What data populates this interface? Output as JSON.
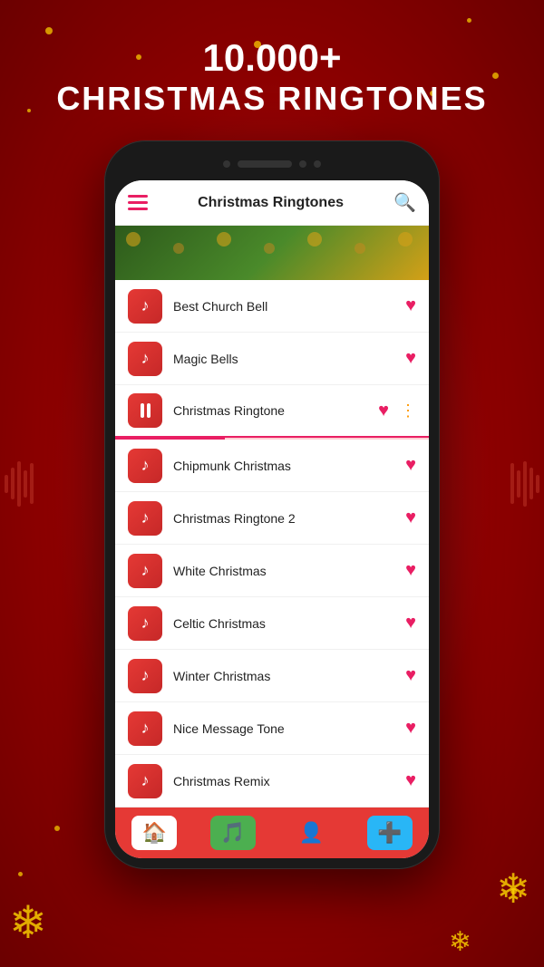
{
  "background": {
    "title_line1": "10.000+",
    "title_line2": "CHRISTMAS RINGTONES"
  },
  "app": {
    "header_title": "Christmas Ringtones",
    "search_icon": "🔍"
  },
  "ringtones": [
    {
      "id": 1,
      "name": "Best Church Bell",
      "playing": false,
      "liked": true
    },
    {
      "id": 2,
      "name": "Magic Bells",
      "playing": false,
      "liked": true
    },
    {
      "id": 3,
      "name": "Christmas Ringtone",
      "playing": true,
      "liked": true,
      "has_more": true
    },
    {
      "id": 4,
      "name": "Chipmunk Christmas",
      "playing": false,
      "liked": true
    },
    {
      "id": 5,
      "name": "Christmas Ringtone 2",
      "playing": false,
      "liked": true
    },
    {
      "id": 6,
      "name": "White Christmas",
      "playing": false,
      "liked": true
    },
    {
      "id": 7,
      "name": "Celtic Christmas",
      "playing": false,
      "liked": true
    },
    {
      "id": 8,
      "name": "Winter Christmas",
      "playing": false,
      "liked": true
    },
    {
      "id": 9,
      "name": "Nice Message Tone",
      "playing": false,
      "liked": true
    },
    {
      "id": 10,
      "name": "Christmas Remix",
      "playing": false,
      "liked": true
    }
  ],
  "bottom_nav": [
    {
      "id": "home",
      "icon": "🏠",
      "active": true,
      "label": "Home"
    },
    {
      "id": "ringtones",
      "icon": "🎵",
      "active": false,
      "label": "Ringtones",
      "style": "green"
    },
    {
      "id": "profile",
      "icon": "👤",
      "active": false,
      "label": "Profile"
    },
    {
      "id": "add",
      "icon": "➕",
      "active": false,
      "label": "Add",
      "style": "blue"
    }
  ]
}
